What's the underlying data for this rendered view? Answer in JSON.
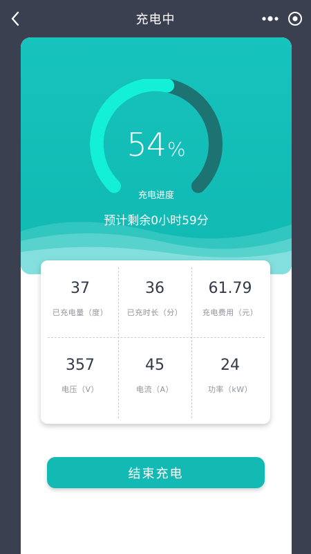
{
  "nav": {
    "title": "充电中",
    "icons": [
      "back-arrow-icon",
      "more-dots-icon",
      "target-circle-icon"
    ]
  },
  "gauge": {
    "progress_fraction": 0.54,
    "percent_value": "54",
    "percent_sign": "%",
    "label": "充电进度",
    "remaining": "预计剩余0小时59分"
  },
  "stats": [
    {
      "value": "37",
      "label": "已充电量（度）"
    },
    {
      "value": "36",
      "label": "已充时长（分）"
    },
    {
      "value": "61.79",
      "label": "充电费用（元）"
    },
    {
      "value": "357",
      "label": "电压（V）"
    },
    {
      "value": "45",
      "label": "电流（A）"
    },
    {
      "value": "24",
      "label": "功率（kW）"
    }
  ],
  "actions": {
    "end_label": "结束充电"
  },
  "colors": {
    "accent": "#12bab3",
    "gauge_fill": "#14f0d8",
    "gauge_track": "#1d7372",
    "backdrop": "#3b4050"
  }
}
